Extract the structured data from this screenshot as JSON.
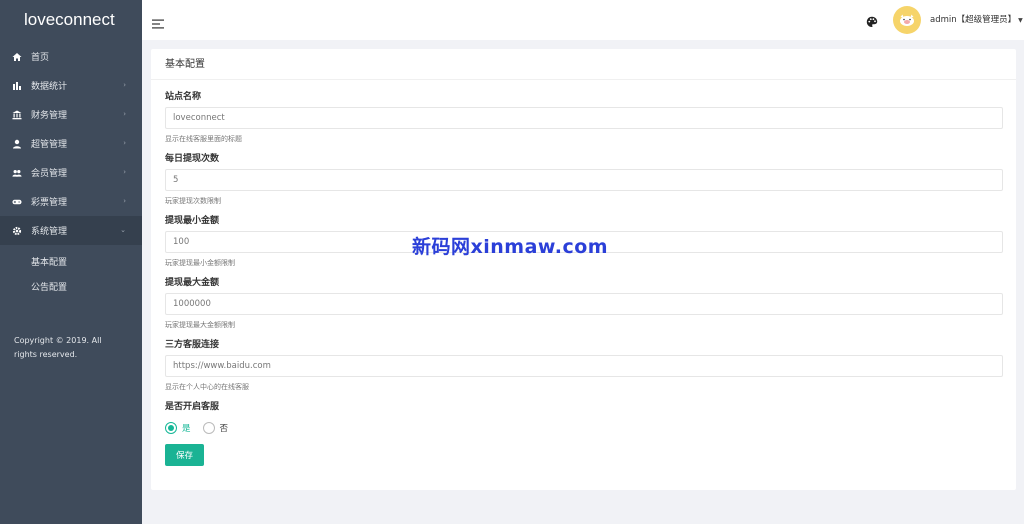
{
  "app": {
    "brand": "loveconnect"
  },
  "sidebar": {
    "items": [
      {
        "label": "首页",
        "icon": "home-icon",
        "has_children": false
      },
      {
        "label": "数据统计",
        "icon": "bar-chart-icon",
        "has_children": true
      },
      {
        "label": "财务管理",
        "icon": "bank-icon",
        "has_children": true
      },
      {
        "label": "超管管理",
        "icon": "user-icon",
        "has_children": true
      },
      {
        "label": "会员管理",
        "icon": "users-icon",
        "has_children": true
      },
      {
        "label": "彩票管理",
        "icon": "gamepad-icon",
        "has_children": true
      },
      {
        "label": "系统管理",
        "icon": "gear-icon",
        "has_children": true,
        "expanded": true
      }
    ],
    "sub_items": [
      {
        "label": "基本配置"
      },
      {
        "label": "公告配置"
      }
    ],
    "copyright": "Copyright © 2019. All rights reserved."
  },
  "topbar": {
    "username": "admin【超级管理员】"
  },
  "card": {
    "title": "基本配置",
    "fields": [
      {
        "label": "站点名称",
        "value": "loveconnect",
        "help": "显示在线客服里面的标题"
      },
      {
        "label": "每日提现次数",
        "value": "5",
        "help": "玩家提现次数限制"
      },
      {
        "label": "提现最小金额",
        "value": "100",
        "help": "玩家提现最小金额限制"
      },
      {
        "label": "提现最大金额",
        "value": "1000000",
        "help": "玩家提现最大金额限制"
      },
      {
        "label": "三方客服连接",
        "value": "https://www.baidu.com",
        "help": "显示在个人中心的在线客服"
      }
    ],
    "service_toggle": {
      "label": "是否开启客服",
      "options": [
        {
          "label": "是",
          "checked": true
        },
        {
          "label": "否",
          "checked": false
        }
      ]
    },
    "save_label": "保存"
  },
  "watermark": "新码网xinmaw.com",
  "colors": {
    "accent": "#1ab394",
    "sidebar_bg": "#3f4b5b"
  }
}
